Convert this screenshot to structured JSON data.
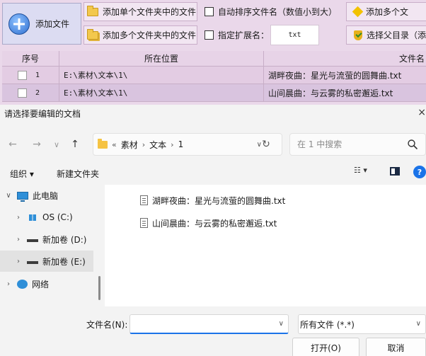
{
  "app": {
    "add_file_label": "添加文件",
    "add_single_folder_label": "添加单个文件夹中的文件",
    "add_multi_folder_label": "添加多个文件夹中的文件",
    "auto_sort_label": "自动排序文件名（数值小到大）",
    "specify_ext_label": "指定扩展名：",
    "ext_value": "txt",
    "add_multi_right_label": "添加多个文",
    "choose_parent_label": "选择父目录（添",
    "table": {
      "headers": [
        "序号",
        "所在位置",
        "文件名"
      ],
      "rows": [
        {
          "num": "1",
          "location": "E:\\素材\\文本\\1\\",
          "filename": "湖畔夜曲：星光与流萤的圆舞曲.txt"
        },
        {
          "num": "2",
          "location": "E:\\素材\\文本\\1\\",
          "filename": "山间晨曲：与云雾的私密邂逅.txt"
        }
      ]
    }
  },
  "dialog": {
    "title": "请选择要编辑的文档",
    "close_glyph": "×",
    "nav": {
      "back": "←",
      "forward": "→",
      "recent": "∨",
      "up": "↑"
    },
    "address": {
      "prefix": "«",
      "segments": [
        "素材",
        "文本",
        "1"
      ],
      "separator": "›",
      "dropdown": "∨",
      "refresh": "↻"
    },
    "search_placeholder": "在 1 中搜索",
    "toolbar": {
      "organize": "组织 ▾",
      "new_folder": "新建文件夹",
      "view_glyph": "☷ ▾",
      "help": "?"
    },
    "tree": [
      {
        "chevron": "∨",
        "label": "此电脑"
      },
      {
        "chevron": "›",
        "label": "OS (C:)"
      },
      {
        "chevron": "›",
        "label": "新加卷 (D:)"
      },
      {
        "chevron": "›",
        "label": "新加卷 (E:)"
      },
      {
        "chevron": "›",
        "label": "网络"
      }
    ],
    "files": [
      "湖畔夜曲：星光与流萤的圆舞曲.txt",
      "山间晨曲：与云雾的私密邂逅.txt"
    ],
    "filename_label": "文件名(N):",
    "filename_value": "",
    "filter_value": "所有文件 (*.*)",
    "dropdown_glyph": "∨",
    "open_label": "打开(O)",
    "cancel_label": "取消"
  }
}
